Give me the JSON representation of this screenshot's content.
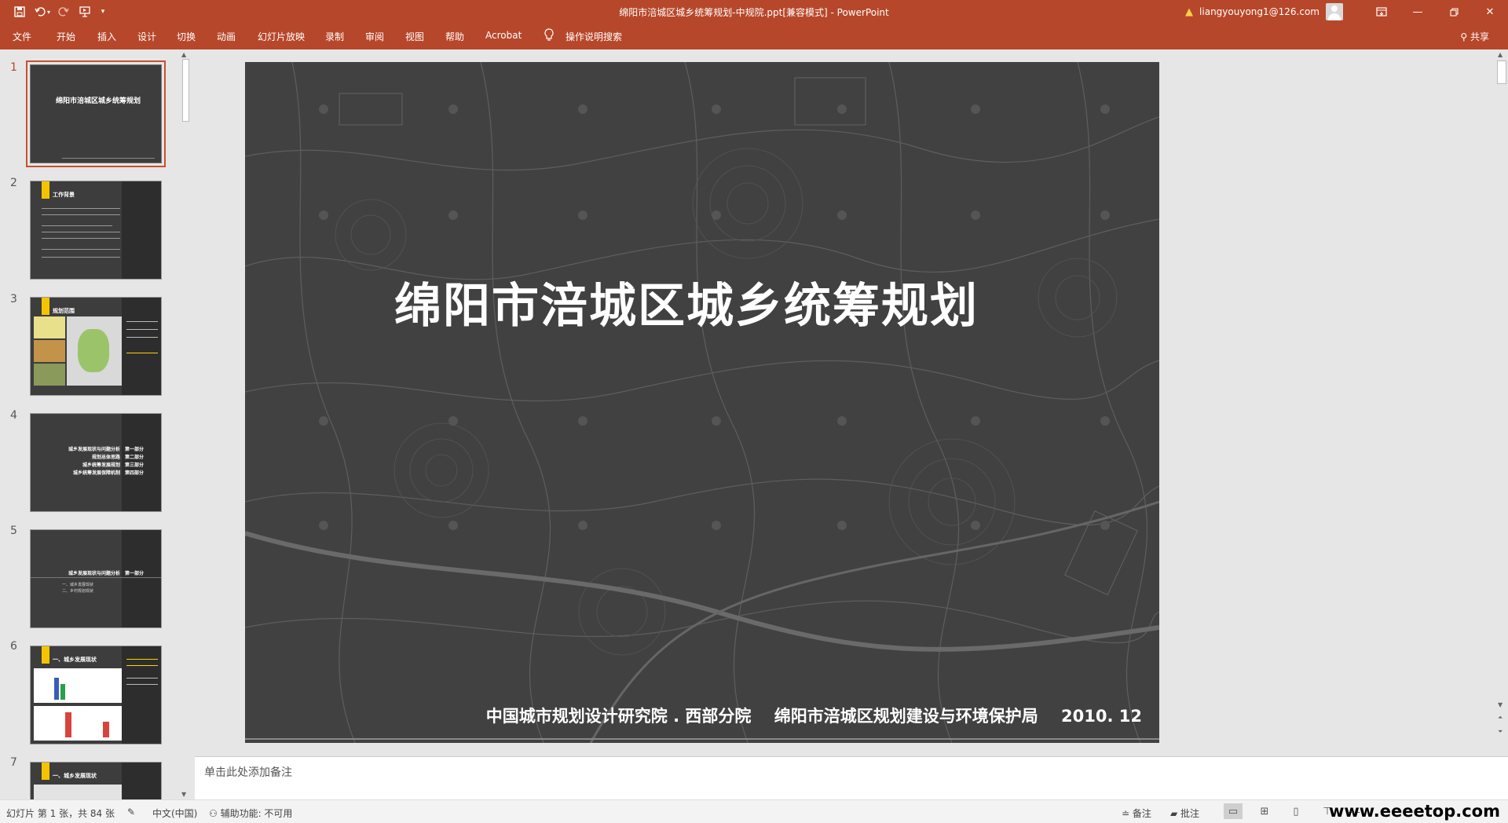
{
  "window": {
    "title": "绵阳市涪城区城乡统筹规划-中规院.ppt[兼容模式]  -  PowerPoint",
    "user": "liangyouyong1@126.com"
  },
  "ribbon": {
    "tabs": [
      "文件",
      "开始",
      "插入",
      "设计",
      "切换",
      "动画",
      "幻灯片放映",
      "录制",
      "审阅",
      "视图",
      "帮助",
      "Acrobat",
      "操作说明搜索"
    ],
    "share": "共享"
  },
  "thumbnails": [
    {
      "num": "1",
      "title": "绵阳市涪城区城乡统筹规划"
    },
    {
      "num": "2",
      "title": "工作背景"
    },
    {
      "num": "3",
      "title": "规划范围"
    },
    {
      "num": "4",
      "lines": [
        "城乡发展现状与问题分析",
        "规划总体思路",
        "城乡统筹发展规划",
        "城乡统筹发展保障机制"
      ],
      "parts": [
        "第一部分",
        "第二部分",
        "第三部分",
        "第四部分"
      ]
    },
    {
      "num": "5",
      "title": "城乡发展现状与问题分析",
      "part": "第一部分",
      "items": [
        "一、城乡发展现状",
        "二、乡村规划现状"
      ]
    },
    {
      "num": "6",
      "title": "一、城乡发展现状"
    },
    {
      "num": "7",
      "title": "一、城乡发展现状"
    }
  ],
  "slide": {
    "title": "绵阳市涪城区城乡统筹规划",
    "footer_org1": "中国城市规划设计研究院 . 西部分院",
    "footer_org2": "绵阳市涪城区规划建设与环境保护局",
    "footer_date": "2010. 12"
  },
  "notes": {
    "placeholder": "单击此处添加备注"
  },
  "status": {
    "slide_info": "幻灯片 第 1 张，共 84 张",
    "language": "中文(中国)",
    "accessibility": "辅助功能: 不可用",
    "notes_btn": "备注",
    "comments_btn": "批注",
    "watermark": "www.eeeetop.com"
  },
  "colors": {
    "accent": "#b7472a",
    "slide_bg": "#414141",
    "highlight": "#f5c400"
  }
}
